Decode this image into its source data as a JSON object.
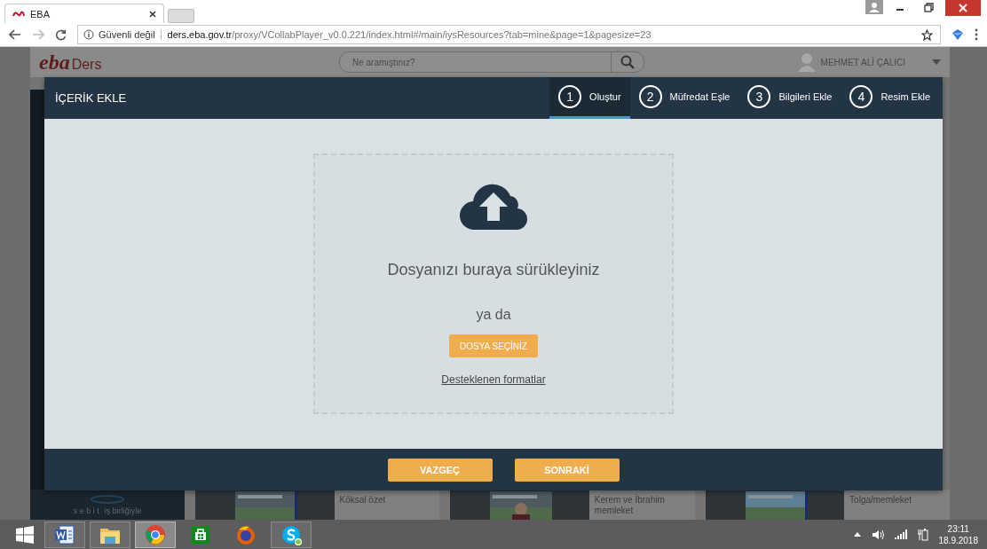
{
  "browser": {
    "tab_title": "EBA",
    "url_security": "Güvenli değil",
    "url_host": "ders.eba.gov.tr",
    "url_path": "/proxy/VCollabPlayer_v0.0.221/index.html#/main/iysResources?tab=mine&page=1&pagesize=23"
  },
  "background_page": {
    "logo_mark": "eba",
    "logo_text": "Ders",
    "search_placeholder": "Ne aramıştınız?",
    "user_name": "MEHMET ALİ ÇALICI",
    "partner_name": "s e b i t",
    "partner_caption": "iş birliğiyle",
    "cards": [
      {
        "kind": "picture"
      },
      {
        "kind": "text",
        "title": "Köksal özet"
      },
      {
        "kind": "picture"
      },
      {
        "kind": "text",
        "title": "Kerem ve İbrahim memleket"
      },
      {
        "kind": "picture"
      },
      {
        "kind": "text",
        "title": "Tolga/memleket"
      }
    ]
  },
  "dialog": {
    "title": "İÇERİK EKLE",
    "steps": [
      {
        "number": "1",
        "label": "Oluştur",
        "selected": true
      },
      {
        "number": "2",
        "label": "Müfredat Eşle",
        "selected": false
      },
      {
        "number": "3",
        "label": "Bilgileri Ekle",
        "selected": false
      },
      {
        "number": "4",
        "label": "Resim Ekle",
        "selected": false
      }
    ],
    "drop_prompt": "Dosyanızı buraya sürükleyiniz",
    "or_text": "ya da",
    "choose_button": "DOSYA SEÇİNİZ",
    "formats_link": "Desteklenen formatlar",
    "buttons": [
      "VAZGEÇ",
      "SONRAKİ"
    ]
  },
  "taskbar": {
    "apps": [
      {
        "kind": "word",
        "open": true,
        "selected": false
      },
      {
        "kind": "explorer",
        "open": true,
        "selected": false
      },
      {
        "kind": "chrome",
        "open": true,
        "selected": true
      },
      {
        "kind": "store",
        "open": false,
        "selected": false
      },
      {
        "kind": "firefox",
        "open": false,
        "selected": false
      },
      {
        "kind": "skype",
        "open": true,
        "selected": false
      }
    ],
    "time": "23:11",
    "date": "18.9.2018"
  }
}
